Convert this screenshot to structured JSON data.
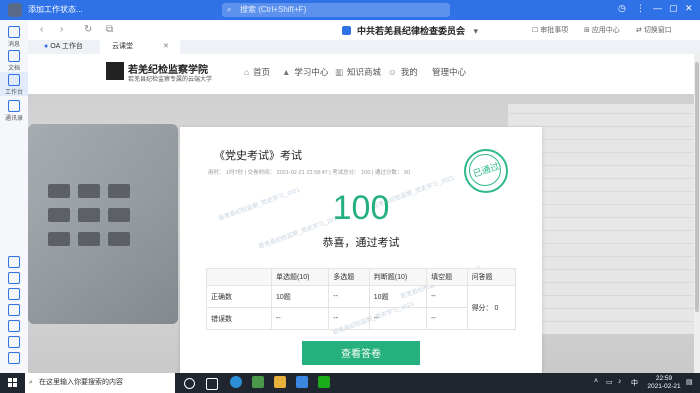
{
  "titlebar": {
    "status": "添加工作状态...",
    "search_placeholder": "搜索 (Ctrl+Shift+F)"
  },
  "sidebar": {
    "items": [
      {
        "label": "消息",
        "icon": "chat-icon"
      },
      {
        "label": "文档",
        "icon": "doc-icon"
      },
      {
        "label": "工作台",
        "icon": "grid-icon"
      },
      {
        "label": "通讯录",
        "icon": "contacts-icon"
      }
    ]
  },
  "navbar": {
    "org_name": "中共若羌县纪律检查委员会",
    "pending": "审批事项",
    "app_center": "应用中心",
    "switch_window": "切换窗口"
  },
  "tabs": [
    {
      "label": "OA 工作台"
    },
    {
      "label": "云课堂"
    }
  ],
  "site": {
    "brand": "若羌纪检监察学院",
    "subtitle": "若羌县纪检监察专属的云端大学",
    "menu": [
      "首页",
      "学习中心",
      "知识商城",
      "我的",
      "管理中心"
    ]
  },
  "exam": {
    "title": "《党史考试》考试",
    "meta": "用时： 1时7秒  |  交卷时间： 2021-02-21 22:58:47  |  考试总分： 100  |  通过分数： 90",
    "score": "100",
    "message": "恭喜，通过考试",
    "stamp": "已通过",
    "watermark": "若羌县纪检监察_党史学习_2021",
    "table": {
      "headers": [
        "",
        "单选题(10)",
        "多选题",
        "判断题(10)",
        "填空题",
        "问答题"
      ],
      "rows": [
        [
          "正确数",
          "10题",
          "--",
          "10题",
          "--"
        ],
        [
          "错误数",
          "--",
          "--",
          "--",
          "--"
        ]
      ],
      "qa_score": "得分： 0"
    },
    "view_button": "查看答卷"
  },
  "taskbar": {
    "search_placeholder": "在这里输入你要搜索的内容",
    "ime": "中",
    "time": "22:59",
    "date": "2021-02-21"
  }
}
